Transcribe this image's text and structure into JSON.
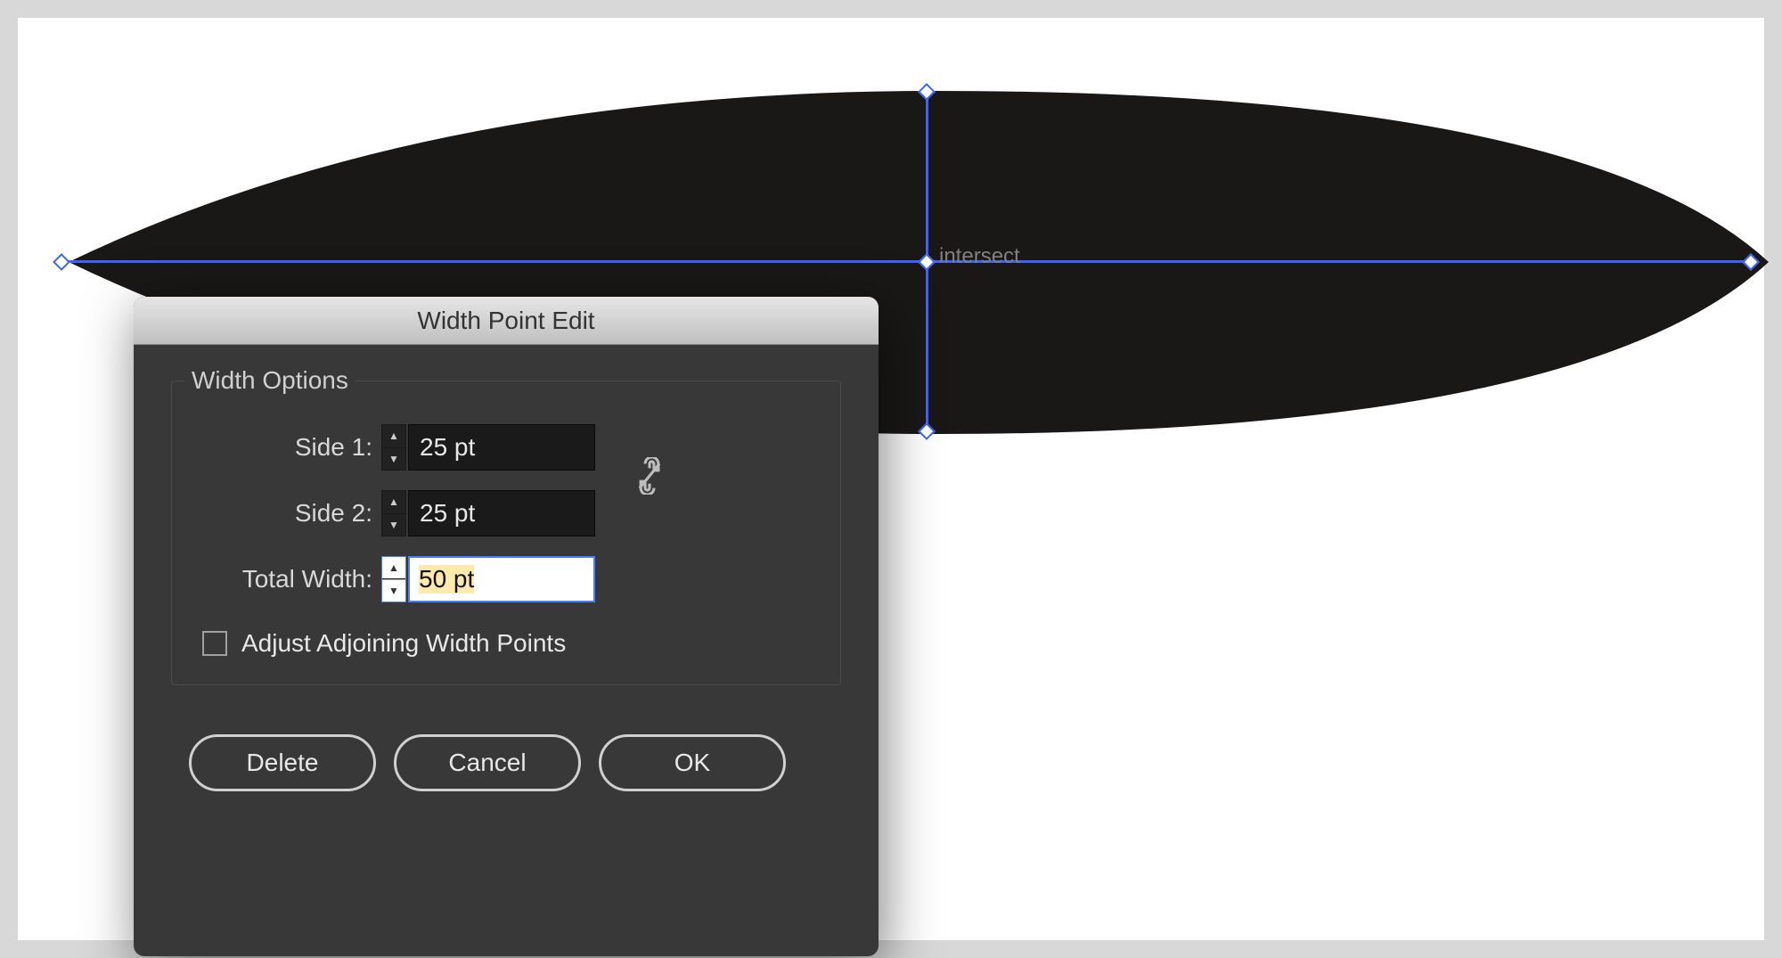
{
  "canvas": {
    "intersect_label": "intersect"
  },
  "dialog": {
    "title": "Width Point Edit",
    "group_title": "Width Options",
    "fields": {
      "side1": {
        "label": "Side 1:",
        "value": "25 pt"
      },
      "side2": {
        "label": "Side 2:",
        "value": "25 pt"
      },
      "total": {
        "label": "Total Width:",
        "value": "50 pt"
      }
    },
    "link_sides": false,
    "adjust_checkbox": {
      "checked": false,
      "label": "Adjust Adjoining Width Points"
    },
    "buttons": {
      "delete": "Delete",
      "cancel": "Cancel",
      "ok": "OK"
    }
  }
}
